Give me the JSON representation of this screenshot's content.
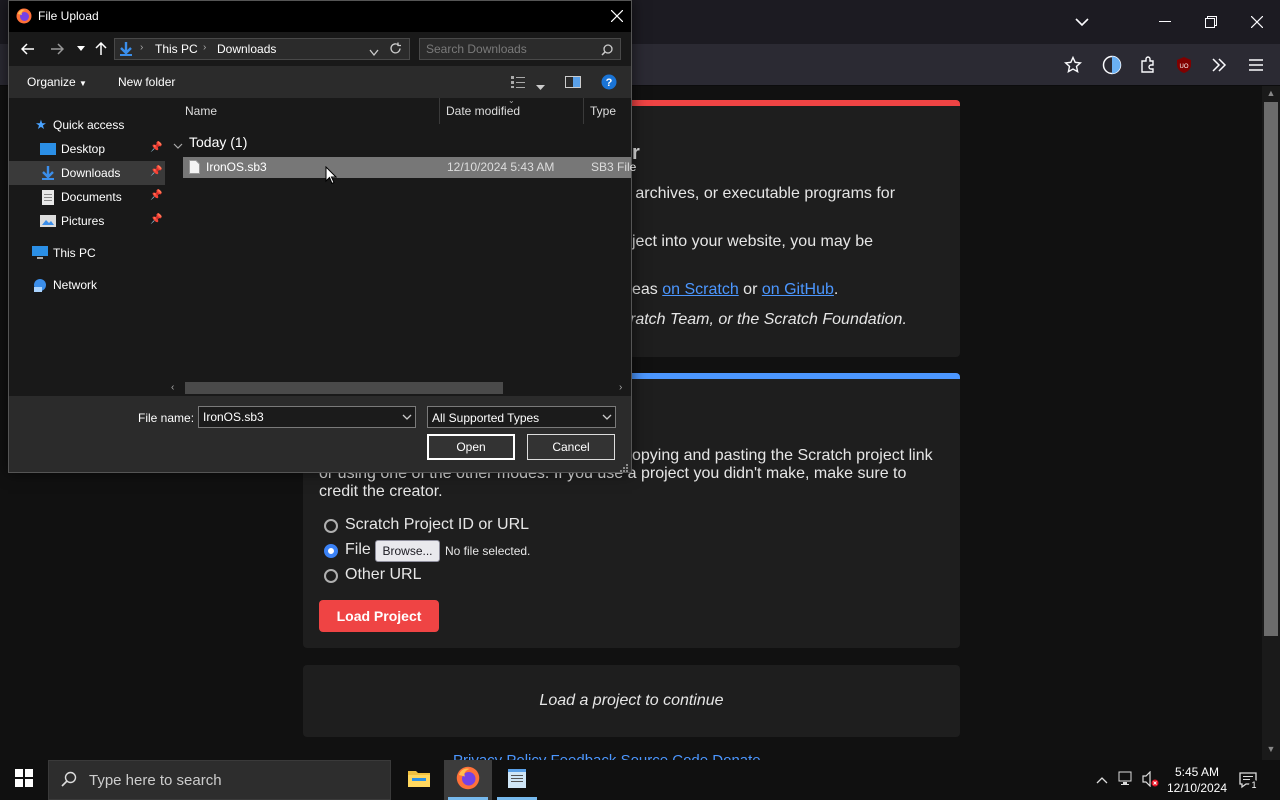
{
  "dialog": {
    "title": "File Upload",
    "breadcrumb": [
      "This PC",
      "Downloads"
    ],
    "search_placeholder": "Search Downloads",
    "toolbar": {
      "organize": "Organize",
      "new_folder": "New folder"
    },
    "nav": [
      {
        "label": "Quick access"
      },
      {
        "label": "Desktop"
      },
      {
        "label": "Downloads"
      },
      {
        "label": "Documents"
      },
      {
        "label": "Pictures"
      },
      {
        "label": "This PC"
      },
      {
        "label": "Network"
      }
    ],
    "columns": {
      "name": "Name",
      "date": "Date modified",
      "type": "Type"
    },
    "group": "Today (1)",
    "file": {
      "name": "IronOS.sb3",
      "date": "12/10/2024 5:43 AM",
      "type": "SB3 File"
    },
    "filename_label": "File name:",
    "filename_value": "IronOS.sb3",
    "file_type": "All Supported Types",
    "open": "Open",
    "cancel": "Cancel"
  },
  "page": {
    "line1": "p archives, or executable programs for",
    "line2": "ject into your website, you may be",
    "line3_pre": "eas ",
    "link_scratch": "on Scratch",
    "line3_mid": " or ",
    "link_github": "on GitHub",
    "line3_post": ".",
    "line4": "ratch Team, or the Scratch Foundation.",
    "line5": "opying and pasting the Scratch project link",
    "line6": "or using one of the other modes. If you use a project you didn't make, make sure to",
    "line7": "credit the creator.",
    "radio_project": "Scratch Project ID or URL",
    "radio_file": "File",
    "browse": "Browse...",
    "no_file": "No file selected.",
    "radio_url": "Other URL",
    "load": "Load Project",
    "continue": "Load a project to continue",
    "footer": "Privacy Policy  Feedback  Source Code  Donate"
  },
  "taskbar": {
    "search_placeholder": "Type here to search",
    "time": "5:45 AM",
    "date": "12/10/2024",
    "notifications": "1"
  },
  "colors": {
    "accent_red": "#ef4444",
    "accent_blue": "#4c97ff",
    "taskbar_underline": "#76b9ed"
  }
}
